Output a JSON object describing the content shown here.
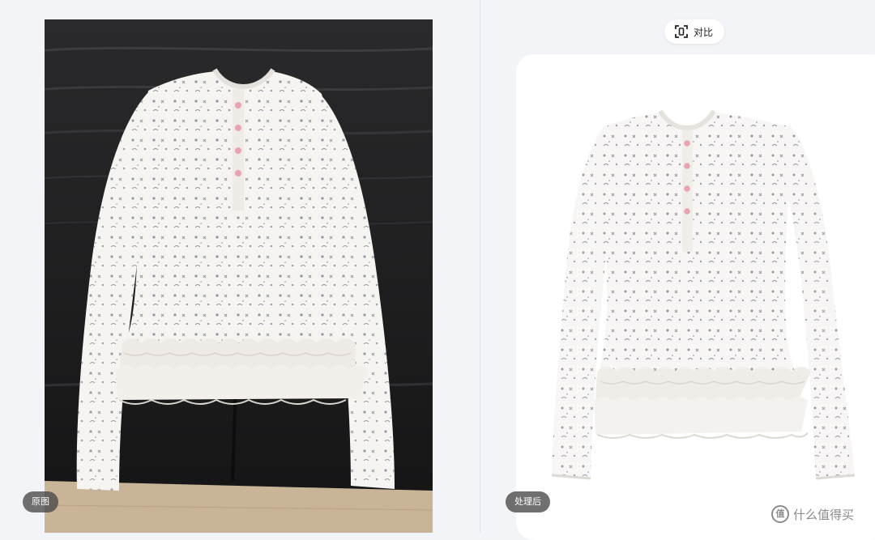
{
  "compare": {
    "icon": "compare-frame-icon",
    "label": "对比"
  },
  "left": {
    "badge": "原图"
  },
  "right": {
    "badge": "处理后"
  },
  "watermark": {
    "icon": "zhi-logo-icon",
    "glyph": "值",
    "text": "什么值得买"
  },
  "colors": {
    "background": "#f3f4f8",
    "sofa": "#1a1a1b",
    "floor": "#c9b497",
    "garment": "#f6f4f1",
    "print": "#7e8398",
    "buttons": "#e9a3b2"
  }
}
